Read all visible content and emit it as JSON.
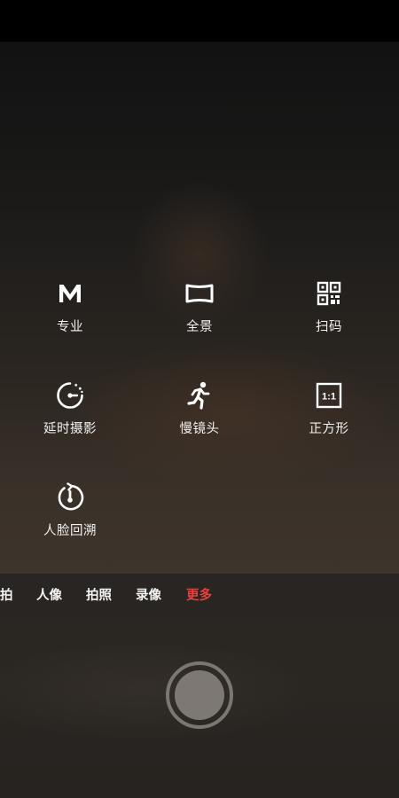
{
  "modes": [
    {
      "label": "专业",
      "icon": "manual-m-icon"
    },
    {
      "label": "全景",
      "icon": "panorama-icon"
    },
    {
      "label": "扫码",
      "icon": "qr-code-icon"
    },
    {
      "label": "延时摄影",
      "icon": "timelapse-icon"
    },
    {
      "label": "慢镜头",
      "icon": "slow-motion-runner-icon"
    },
    {
      "label": "正方形",
      "icon": "square-ratio-icon",
      "icon_text": "1:1"
    },
    {
      "label": "人脸回溯",
      "icon": "face-retro-timer-icon"
    }
  ],
  "tabs": [
    {
      "label": "拍"
    },
    {
      "label": "人像"
    },
    {
      "label": "拍照"
    },
    {
      "label": "录像"
    },
    {
      "label": "更多",
      "active": true
    }
  ],
  "colors": {
    "active_tab": "#e8413b",
    "text": "#f2f2f2",
    "shutter": "#7d7874"
  }
}
